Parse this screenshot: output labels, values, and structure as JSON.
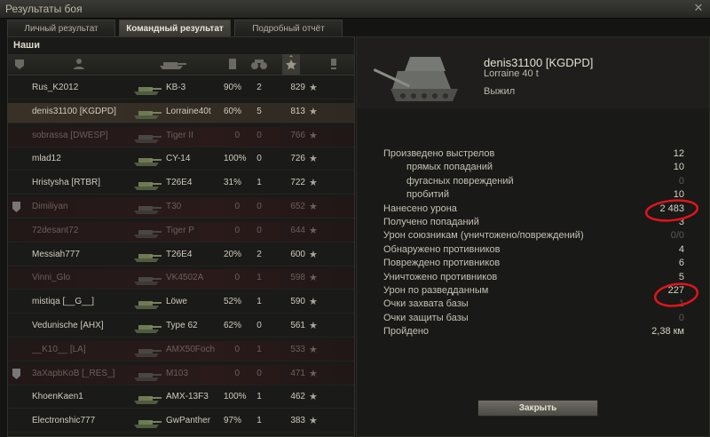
{
  "window": {
    "title": "Результаты боя",
    "close_icon": "close-icon"
  },
  "tabs": [
    {
      "label": "Личный результат",
      "active": false
    },
    {
      "label": "Командный результат",
      "active": true
    },
    {
      "label": "Подробный отчёт",
      "active": false
    }
  ],
  "team": {
    "label": "Наши",
    "header_icons": [
      "squad-icon",
      "player-icon",
      "tank-icon",
      "damage-icon",
      "frags-icon",
      "xp-star-icon",
      "status-icon"
    ],
    "rows": [
      {
        "name": "Rus_K2012",
        "vehicle": "KB-3",
        "pct": "90%",
        "kills": "2",
        "xp": "829",
        "dead": false,
        "self": false,
        "clan": false
      },
      {
        "name": "denis31100 [KGDPD]",
        "vehicle": "Lorraine40t",
        "pct": "60%",
        "kills": "5",
        "xp": "813",
        "dead": false,
        "self": true,
        "clan": false
      },
      {
        "name": "sobrassa [DWESP]",
        "vehicle": "Tiger II",
        "pct": "0",
        "kills": "0",
        "xp": "766",
        "dead": true,
        "self": false,
        "clan": false
      },
      {
        "name": "mlad12",
        "vehicle": "CY-14",
        "pct": "100%",
        "kills": "0",
        "xp": "726",
        "dead": false,
        "self": false,
        "clan": false
      },
      {
        "name": "Hristysha [RTBR]",
        "vehicle": "T26E4",
        "pct": "31%",
        "kills": "1",
        "xp": "722",
        "dead": false,
        "self": false,
        "clan": false
      },
      {
        "name": "Dimiliyan",
        "vehicle": "T30",
        "pct": "0",
        "kills": "0",
        "xp": "652",
        "dead": true,
        "self": false,
        "clan": true
      },
      {
        "name": "72desant72",
        "vehicle": "Tiger P",
        "pct": "0",
        "kills": "0",
        "xp": "644",
        "dead": true,
        "self": false,
        "clan": false
      },
      {
        "name": "Messiah777",
        "vehicle": "T26E4",
        "pct": "20%",
        "kills": "2",
        "xp": "600",
        "dead": false,
        "self": false,
        "clan": false
      },
      {
        "name": "Vinni_Glo",
        "vehicle": "VK4502A",
        "pct": "0",
        "kills": "1",
        "xp": "598",
        "dead": true,
        "self": false,
        "clan": false
      },
      {
        "name": "mistiqa [__G__]",
        "vehicle": "Löwe",
        "pct": "52%",
        "kills": "1",
        "xp": "590",
        "dead": false,
        "self": false,
        "clan": false
      },
      {
        "name": "Vedunische [AHX]",
        "vehicle": "Type 62",
        "pct": "62%",
        "kills": "0",
        "xp": "561",
        "dead": false,
        "self": false,
        "clan": false
      },
      {
        "name": "__K10__ [LA]",
        "vehicle": "AMX50Foch",
        "pct": "0",
        "kills": "1",
        "xp": "533",
        "dead": true,
        "self": false,
        "clan": false
      },
      {
        "name": "3aXapbKoB [_RES_]",
        "vehicle": "M103",
        "pct": "0",
        "kills": "0",
        "xp": "471",
        "dead": true,
        "self": false,
        "clan": true
      },
      {
        "name": "KhoenKaen1",
        "vehicle": "AMX-13F3",
        "pct": "100%",
        "kills": "1",
        "xp": "462",
        "dead": false,
        "self": false,
        "clan": false
      },
      {
        "name": "Electronshic777",
        "vehicle": "GwPanther",
        "pct": "97%",
        "kills": "1",
        "xp": "383",
        "dead": false,
        "self": false,
        "clan": false
      }
    ]
  },
  "player": {
    "name": "denis31100 [KGDPD]",
    "tank": "Lorraine 40 t",
    "status": "Выжил"
  },
  "stats": [
    {
      "label": "Произведено выстрелов",
      "value": "12",
      "indent": false,
      "dim": false
    },
    {
      "label": "прямых попаданий",
      "value": "10",
      "indent": true,
      "dim": false
    },
    {
      "label": "фугасных повреждений",
      "value": "0",
      "indent": true,
      "dim": true
    },
    {
      "label": "пробитий",
      "value": "10",
      "indent": true,
      "dim": false
    },
    {
      "label": "Нанесено урона",
      "value": "2 483",
      "indent": false,
      "dim": false
    },
    {
      "label": "Получено попаданий",
      "value": "3",
      "indent": false,
      "dim": false
    },
    {
      "label": "Урон союзникам (уничтожено/повреждений)",
      "value": "0/0",
      "indent": false,
      "dim": true
    },
    {
      "label": "Обнаружено противников",
      "value": "4",
      "indent": false,
      "dim": false
    },
    {
      "label": "Повреждено противников",
      "value": "6",
      "indent": false,
      "dim": false
    },
    {
      "label": "Уничтожено противников",
      "value": "5",
      "indent": false,
      "dim": false
    },
    {
      "label": "Урон по разведданным",
      "value": "227",
      "indent": false,
      "dim": false
    },
    {
      "label": "Очки захвата базы",
      "value": "1",
      "indent": false,
      "dim": true
    },
    {
      "label": "Очки защиты базы",
      "value": "0",
      "indent": false,
      "dim": true
    },
    {
      "label": "Пройдено",
      "value": "2,38 км",
      "indent": false,
      "dim": false
    }
  ],
  "close_button": {
    "label": "Закрыть"
  },
  "colors": {
    "annotation": "#e0141c",
    "dead_row": "#2a1a1a",
    "self_row": "#3a3126"
  }
}
